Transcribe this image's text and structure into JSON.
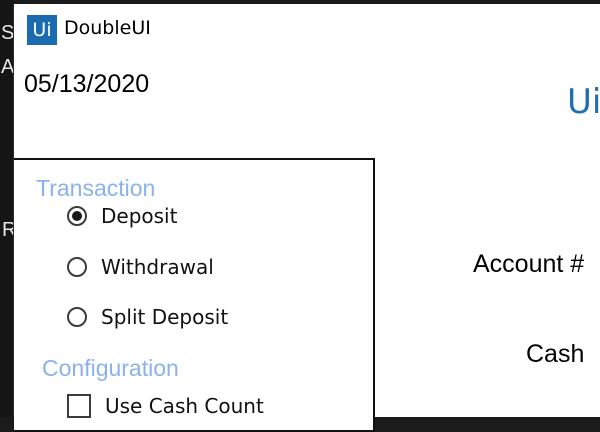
{
  "background_window": {
    "edge_chars": [
      "S",
      "A",
      "R"
    ]
  },
  "app": {
    "logo_text": "Ui",
    "title": "DoubleUI",
    "brand_mark": "Ui",
    "accent_color": "#1a6bb0"
  },
  "header": {
    "date": "05/13/2020"
  },
  "transaction": {
    "title": "Transaction",
    "options": [
      {
        "label": "Deposit",
        "selected": true
      },
      {
        "label": "Withdrawal",
        "selected": false
      },
      {
        "label": "Split Deposit",
        "selected": false
      }
    ]
  },
  "configuration": {
    "title": "Configuration",
    "use_cash_count": {
      "label": "Use Cash Count",
      "checked": false
    }
  },
  "form": {
    "account_label": "Account #",
    "cash_label": "Cash"
  }
}
